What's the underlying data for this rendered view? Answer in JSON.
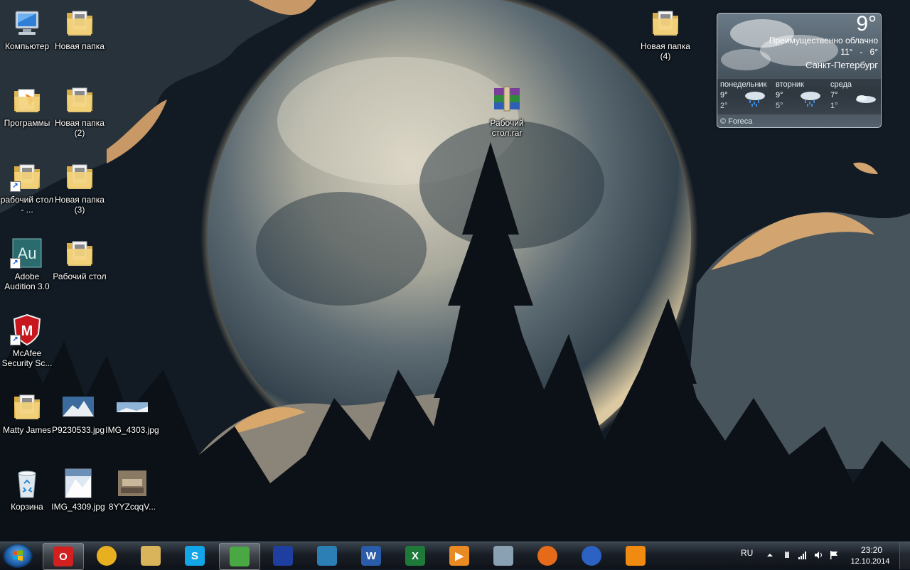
{
  "desktop_icons": [
    {
      "id": "computer",
      "label": "Компьютер",
      "type": "computer",
      "shortcut": false
    },
    {
      "id": "folder-new",
      "label": "Новая папка",
      "type": "folder",
      "shortcut": false
    },
    {
      "id": "programs",
      "label": "Программы",
      "type": "folder-orange",
      "shortcut": false
    },
    {
      "id": "folder-new-2",
      "label": "Новая папка (2)",
      "type": "folder",
      "shortcut": false
    },
    {
      "id": "desktop-shortcut",
      "label": "рабочий стол - ...",
      "type": "folder",
      "shortcut": true
    },
    {
      "id": "folder-new-3",
      "label": "Новая папка (3)",
      "type": "folder",
      "shortcut": false
    },
    {
      "id": "audition",
      "label": "Adobe Audition 3.0",
      "type": "audition",
      "shortcut": true
    },
    {
      "id": "desktop-folder",
      "label": "Рабочий стол",
      "type": "folder",
      "shortcut": false
    },
    {
      "id": "mcafee",
      "label": "McAfee Security Sc...",
      "type": "mcafee",
      "shortcut": true
    },
    {
      "id": "matty",
      "label": "Matty James",
      "type": "folder",
      "shortcut": false
    },
    {
      "id": "p9230533",
      "label": "P9230533.jpg",
      "type": "photo-mountain",
      "shortcut": false
    },
    {
      "id": "img4303",
      "label": "IMG_4303.jpg",
      "type": "photo-landscape",
      "shortcut": false
    },
    {
      "id": "recycle",
      "label": "Корзина",
      "type": "recycle",
      "shortcut": false
    },
    {
      "id": "img4309",
      "label": "IMG_4309.jpg",
      "type": "photo-snow",
      "shortcut": false
    },
    {
      "id": "8yyz",
      "label": "8YYZcqqV...",
      "type": "photo-room",
      "shortcut": false
    },
    {
      "id": "rar",
      "label": "Рабочий стол.rar",
      "type": "rar",
      "shortcut": false
    },
    {
      "id": "folder-new-4",
      "label": "Новая папка (4)",
      "type": "folder",
      "shortcut": false
    }
  ],
  "weather": {
    "temp_now": "9°",
    "condition": "Преимущественно облачно",
    "range_hi": "11°",
    "range_sep": "-",
    "range_lo": "6°",
    "city": "Санкт-Петербург",
    "days": [
      {
        "name": "понедельник",
        "hi": "9°",
        "lo": "2°"
      },
      {
        "name": "вторник",
        "hi": "9°",
        "lo": "5°"
      },
      {
        "name": "среда",
        "hi": "7°",
        "lo": "1°"
      }
    ],
    "credit": "© Foreca"
  },
  "taskbar": {
    "apps": [
      {
        "id": "opera",
        "letter": "O",
        "color": "#d21f1f",
        "active": true
      },
      {
        "id": "chrome",
        "letter": "",
        "color": "#e8b020",
        "active": false
      },
      {
        "id": "explorer",
        "letter": "",
        "color": "#d9b45a",
        "active": false
      },
      {
        "id": "skype",
        "letter": "S",
        "color": "#12a5e8",
        "active": false
      },
      {
        "id": "utorrent",
        "letter": "",
        "color": "#4aa844",
        "active": true
      },
      {
        "id": "save",
        "letter": "",
        "color": "#1f3fa0",
        "active": false
      },
      {
        "id": "quill",
        "letter": "",
        "color": "#2c7fb5",
        "active": false
      },
      {
        "id": "word",
        "letter": "W",
        "color": "#2a5caa",
        "active": false
      },
      {
        "id": "excel",
        "letter": "X",
        "color": "#1f7a3a",
        "active": false
      },
      {
        "id": "media",
        "letter": "▶",
        "color": "#e98a22",
        "active": false
      },
      {
        "id": "calculator",
        "letter": "",
        "color": "#8aa1b3",
        "active": false
      },
      {
        "id": "firefox",
        "letter": "",
        "color": "#e56a1a",
        "active": false
      },
      {
        "id": "earth",
        "letter": "",
        "color": "#2c62c4",
        "active": false
      },
      {
        "id": "avast",
        "letter": "",
        "color": "#f08a10",
        "active": false
      }
    ],
    "language": "RU",
    "time": "23:20",
    "date": "12.10.2014"
  }
}
